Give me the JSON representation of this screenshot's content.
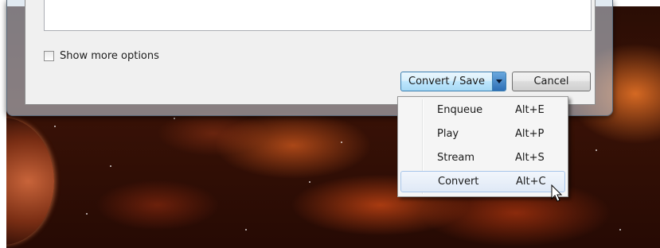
{
  "dialog": {
    "show_more_options_label": "Show more options",
    "show_more_options_checked": false,
    "convert_save_label": "Convert / Save",
    "cancel_label": "Cancel"
  },
  "menu": {
    "items": [
      {
        "label": "Enqueue",
        "shortcut": "Alt+E"
      },
      {
        "label": "Play",
        "shortcut": "Alt+P"
      },
      {
        "label": "Stream",
        "shortcut": "Alt+S"
      },
      {
        "label": "Convert",
        "shortcut": "Alt+C",
        "highlighted": true
      }
    ]
  },
  "colors": {
    "accent_button": "#bee6fd",
    "menu_highlight": "#dfe9f6",
    "wallpaper": "#3a1206"
  },
  "icons": [
    "dropdown-arrow-icon",
    "mouse-cursor-icon"
  ]
}
